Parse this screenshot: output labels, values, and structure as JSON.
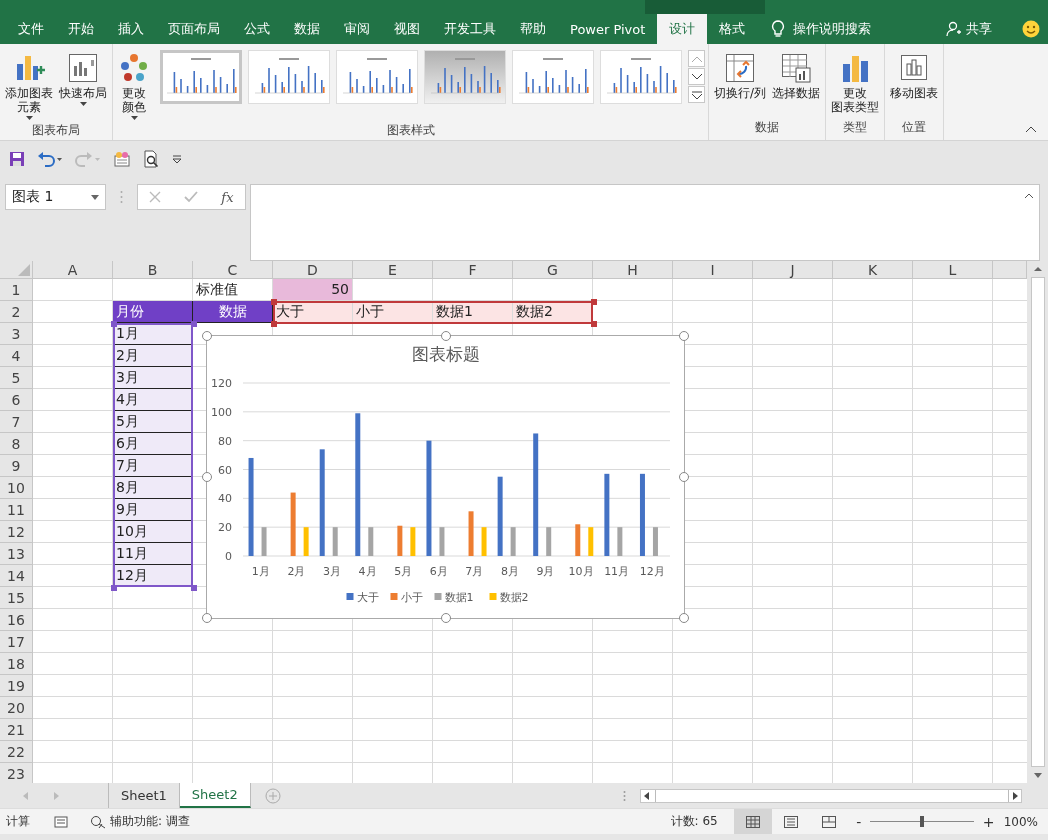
{
  "ribbon_tabs": [
    {
      "label": "文件",
      "selected": false
    },
    {
      "label": "开始",
      "selected": false
    },
    {
      "label": "插入",
      "selected": false
    },
    {
      "label": "页面布局",
      "selected": false
    },
    {
      "label": "公式",
      "selected": false
    },
    {
      "label": "数据",
      "selected": false
    },
    {
      "label": "审阅",
      "selected": false
    },
    {
      "label": "视图",
      "selected": false
    },
    {
      "label": "开发工具",
      "selected": false
    },
    {
      "label": "帮助",
      "selected": false
    },
    {
      "label": "Power Pivot",
      "selected": false
    },
    {
      "label": "设计",
      "selected": true
    },
    {
      "label": "格式",
      "selected": false
    }
  ],
  "tell_me": "操作说明搜索",
  "share": "共享",
  "ribbon_groups": [
    {
      "label": "图表布局",
      "buttons": [
        {
          "kind": "add-element",
          "lines": [
            "添加图表",
            "元素"
          ],
          "dropdown": true
        },
        {
          "kind": "quick-layout",
          "lines": [
            "快速布局"
          ],
          "dropdown": true
        }
      ]
    },
    {
      "label": "图表样式",
      "buttons": [
        {
          "kind": "colors",
          "lines": [
            "更改",
            "颜色"
          ],
          "dropdown": true
        }
      ],
      "gallery": [
        {
          "selected": true,
          "shaded": false
        },
        {
          "selected": false,
          "shaded": false
        },
        {
          "selected": false,
          "shaded": false
        },
        {
          "selected": false,
          "shaded": true
        },
        {
          "selected": false,
          "shaded": false
        },
        {
          "selected": false,
          "shaded": false
        }
      ]
    },
    {
      "label": "数据",
      "buttons": [
        {
          "kind": "switch",
          "lines": [
            "切换行/列"
          ],
          "dropdown": false
        },
        {
          "kind": "select-data",
          "lines": [
            "选择数据"
          ],
          "dropdown": false
        }
      ]
    },
    {
      "label": "类型",
      "buttons": [
        {
          "kind": "change-type",
          "lines": [
            "更改",
            "图表类型"
          ],
          "dropdown": false
        }
      ]
    },
    {
      "label": "位置",
      "buttons": [
        {
          "kind": "move",
          "lines": [
            "移动图表"
          ],
          "dropdown": false
        }
      ]
    }
  ],
  "name_box": "图表 1",
  "fx_label": "fx",
  "sheet": {
    "columns": [
      "A",
      "B",
      "C",
      "D",
      "E",
      "F",
      "G",
      "H",
      "I",
      "J",
      "K",
      "L"
    ],
    "rows": [
      {
        "number": "1",
        "cells": [
          null,
          null,
          {
            "text": "标准值",
            "kind": "plain"
          },
          {
            "text": "50",
            "kind": "value"
          }
        ]
      },
      {
        "number": "2",
        "cells": [
          null,
          {
            "text": "月份",
            "kind": "header"
          },
          {
            "text": "数据",
            "kind": "header-center"
          },
          {
            "text": "大于",
            "kind": "series"
          },
          {
            "text": "小于",
            "kind": "series"
          },
          {
            "text": "数据1",
            "kind": "series"
          },
          {
            "text": "数据2",
            "kind": "series"
          }
        ]
      },
      {
        "number": "3",
        "cells": [
          null,
          {
            "text": "1月",
            "kind": "month"
          }
        ]
      },
      {
        "number": "4",
        "cells": [
          null,
          {
            "text": "2月",
            "kind": "month"
          }
        ]
      },
      {
        "number": "5",
        "cells": [
          null,
          {
            "text": "3月",
            "kind": "month"
          }
        ]
      },
      {
        "number": "6",
        "cells": [
          null,
          {
            "text": "4月",
            "kind": "month"
          }
        ]
      },
      {
        "number": "7",
        "cells": [
          null,
          {
            "text": "5月",
            "kind": "month"
          }
        ]
      },
      {
        "number": "8",
        "cells": [
          null,
          {
            "text": "6月",
            "kind": "month"
          }
        ]
      },
      {
        "number": "9",
        "cells": [
          null,
          {
            "text": "7月",
            "kind": "month"
          }
        ]
      },
      {
        "number": "10",
        "cells": [
          null,
          {
            "text": "8月",
            "kind": "month"
          }
        ]
      },
      {
        "number": "11",
        "cells": [
          null,
          {
            "text": "9月",
            "kind": "month"
          }
        ]
      },
      {
        "number": "12",
        "cells": [
          null,
          {
            "text": "10月",
            "kind": "month"
          }
        ]
      },
      {
        "number": "13",
        "cells": [
          null,
          {
            "text": "11月",
            "kind": "month"
          }
        ]
      },
      {
        "number": "14",
        "cells": [
          null,
          {
            "text": "12月",
            "kind": "month"
          }
        ]
      },
      {
        "number": "15"
      },
      {
        "number": "16"
      },
      {
        "number": "17"
      },
      {
        "number": "18"
      },
      {
        "number": "19"
      },
      {
        "number": "20"
      },
      {
        "number": "21"
      },
      {
        "number": "22"
      },
      {
        "number": "23"
      }
    ]
  },
  "chart": {
    "chart_data": {
      "type": "bar",
      "title": "图表标题",
      "categories": [
        "1月",
        "2月",
        "3月",
        "4月",
        "5月",
        "6月",
        "7月",
        "8月",
        "9月",
        "10月",
        "11月",
        "12月"
      ],
      "series": [
        {
          "name": "大于",
          "color": "#4472c4",
          "values": [
            68,
            null,
            74,
            99,
            null,
            80,
            null,
            55,
            85,
            null,
            57,
            57
          ]
        },
        {
          "name": "小于",
          "color": "#ed7d31",
          "values": [
            null,
            44,
            null,
            null,
            21,
            null,
            31,
            null,
            null,
            22,
            null,
            null
          ]
        },
        {
          "name": "数据1",
          "color": "#a5a5a5",
          "values": [
            20,
            null,
            20,
            20,
            null,
            20,
            null,
            20,
            20,
            null,
            20,
            20
          ]
        },
        {
          "name": "数据2",
          "color": "#ffc000",
          "values": [
            null,
            20,
            null,
            null,
            20,
            null,
            20,
            null,
            null,
            20,
            null,
            null
          ]
        }
      ],
      "ylim": [
        0,
        120
      ],
      "yticks": [
        0,
        20,
        40,
        60,
        80,
        100,
        120
      ],
      "grid": true,
      "legend": true
    }
  },
  "sheet_tabs": [
    {
      "label": "Sheet1",
      "selected": false
    },
    {
      "label": "Sheet2",
      "selected": true
    }
  ],
  "status": {
    "mode": "计算",
    "accessibility": "辅助功能: 调查",
    "count": "计数: 65",
    "views": [
      {
        "selected": true
      },
      {
        "selected": false
      },
      {
        "selected": false
      }
    ],
    "zoom_out": "-",
    "zoom_in": "+",
    "zoom": {
      "level": 0.5,
      "reading": "100%"
    }
  }
}
